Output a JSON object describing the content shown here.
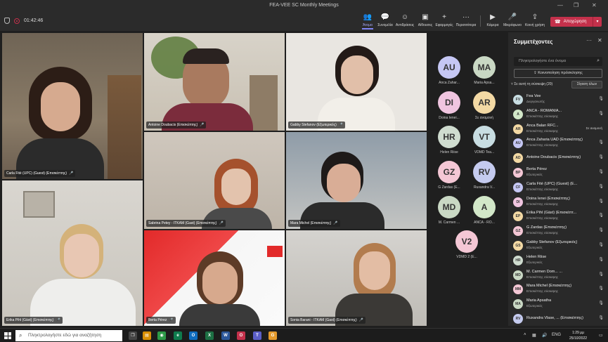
{
  "window": {
    "title": "FEA-VEE SC Monthly Meetings"
  },
  "toolbar": {
    "timer": "01:42:46",
    "buttons": [
      {
        "label": "Άτομα",
        "icon": "people-icon"
      },
      {
        "label": "Συνομιλία",
        "icon": "chat-icon"
      },
      {
        "label": "Αντιδράσεις",
        "icon": "reactions-icon"
      },
      {
        "label": "Αίθουσες",
        "icon": "rooms-icon"
      },
      {
        "label": "Εφαρμογές",
        "icon": "apps-icon"
      },
      {
        "label": "Περισσότερα",
        "icon": "more-icon"
      },
      {
        "label": "Κάμερα",
        "icon": "camera-icon"
      },
      {
        "label": "Μικρόφωνο",
        "icon": "microphone-icon"
      },
      {
        "label": "Κοινή χρήση",
        "icon": "share-icon"
      }
    ],
    "leave_label": "Αποχώρηση"
  },
  "tiles": [
    {
      "name": "Carla Fité (UPC) (Guest) (Επισκέπτης)"
    },
    {
      "name": "Antoine Doubacis (Επισκέπτης)"
    },
    {
      "name": "Gabby Stefanov (Εξωτερικός)"
    },
    {
      "name": "Sabrina Petey - ITKAM (Gast) (Επισκέπτης)"
    },
    {
      "name": "Mara Michel (Επισκέπτης)"
    },
    {
      "name": "Erika Pihl (Gäst) (Επισκέπτης)"
    },
    {
      "name": "Berta Pérez"
    },
    {
      "name": "Sonia Barani - ITKAM (Gast) (Επισκέπτης)"
    }
  ],
  "avatars": [
    {
      "initials": "AU",
      "label": "Anca Zahar...",
      "color": "#c5c7f4"
    },
    {
      "initials": "MA",
      "label": "Maria Apsa...",
      "color": "#c9d8c4"
    },
    {
      "initials": "DI",
      "label": "Doina Ienei...",
      "color": "#f0c5e0"
    },
    {
      "initials": "AR",
      "label": "Σε αναμονή",
      "color": "#f3d9a4"
    },
    {
      "initials": "HR",
      "label": "Helen Riise",
      "color": "#cfdccf"
    },
    {
      "initials": "VT",
      "label": "VDMD Tea...",
      "color": "#c8dde2"
    },
    {
      "initials": "GZ",
      "label": "G Zardas (E...",
      "color": "#f4c7d5"
    },
    {
      "initials": "RV",
      "label": "Ruxandra V...",
      "color": "#c5cbef"
    },
    {
      "initials": "MD",
      "label": "M. Carmen ...",
      "color": "#c9d8c4"
    },
    {
      "initials": "A",
      "label": "ANCA - RO...",
      "color": "#d2e7c8"
    },
    {
      "initials": "V2",
      "label": "VDMD 2 (E...",
      "color": "#f4c7d5"
    }
  ],
  "panel": {
    "title": "Συμμετέχοντες",
    "search_placeholder": "Πληκτρολογήστε ένα όνομα",
    "share_invite": "Κοινοποίηση πρόσκλησης",
    "section": "Σε αυτή τη σύσκεψη (20)",
    "mute_all": "Σίγαση όλων",
    "participants": [
      {
        "initials": "FV",
        "name": "Fea Vee",
        "role": "Διοργανωτής",
        "color": "#c8dde2",
        "status": ""
      },
      {
        "initials": "A",
        "name": "ANCA - ROMANIA...",
        "role": "Επισκέπτης σύσκεψης",
        "color": "#d2e7c8",
        "status": ""
      },
      {
        "initials": "AR",
        "name": "Anca Balan RFC...",
        "role": "Επισκέπτης σύσκεψης",
        "color": "#f3d9a4",
        "status": "Σε αναμονή"
      },
      {
        "initials": "AU",
        "name": "Anca Zaharia UAD (Επισκέπτης)",
        "role": "Επισκέπτης σύσκεψης",
        "color": "#c5c7f4",
        "status": ""
      },
      {
        "initials": "AD",
        "name": "Antoine Doubacis (Επισκέπτης)",
        "role": "",
        "color": "#f3d9a4",
        "status": ""
      },
      {
        "initials": "BP",
        "name": "Berta Pérez",
        "role": "Εξωτερικός",
        "color": "#f4c7d5",
        "status": ""
      },
      {
        "initials": "CF",
        "name": "Carla Fité (UPC) (Guest) (E...",
        "role": "Επισκέπτης σύσκεψης",
        "color": "#c5c7f4",
        "status": ""
      },
      {
        "initials": "DI",
        "name": "Doina Ienei (Επισκέπτης)",
        "role": "Επισκέπτης σύσκεψης",
        "color": "#f0c5e0",
        "status": ""
      },
      {
        "initials": "EP",
        "name": "Erika Pihl (Gäst) (Επισκέπτ...",
        "role": "Επισκέπτης σύσκεψης",
        "color": "#f3d9a4",
        "status": ""
      },
      {
        "initials": "GZ",
        "name": "G Zardas (Επισκέπτης)",
        "role": "Επισκέπτης σύσκεψης",
        "color": "#f4c7d5",
        "status": ""
      },
      {
        "initials": "GS",
        "name": "Gabby Stefanov (Εξωτερικός)",
        "role": "Εξωτερικός",
        "color": "#f3d9a4",
        "status": ""
      },
      {
        "initials": "HR",
        "name": "Helen Riise",
        "role": "Εξωτερικός",
        "color": "#cfdccf",
        "status": ""
      },
      {
        "initials": "MD",
        "name": "M. Carmen Dom... ...",
        "role": "Επισκέπτης σύσκεψης",
        "color": "#c9d8c4",
        "status": ""
      },
      {
        "initials": "MM",
        "name": "Mara Michel (Επισκέπτης)",
        "role": "Επισκέπτης σύσκεψης",
        "color": "#f4c7d5",
        "status": ""
      },
      {
        "initials": "MA",
        "name": "Maria Apsatha",
        "role": "Εξωτερικός",
        "color": "#c9d8c4",
        "status": ""
      },
      {
        "initials": "RV",
        "name": "Ruxandra Vlase, ... (Επισκέπτης)",
        "role": "",
        "color": "#c5cbef",
        "status": ""
      }
    ]
  },
  "taskbar": {
    "search_placeholder": "Πληκτρολογήστε εδώ για αναζήτηση",
    "language": "ENG",
    "time": "1:29 μμ",
    "date": "25/10/2022"
  }
}
